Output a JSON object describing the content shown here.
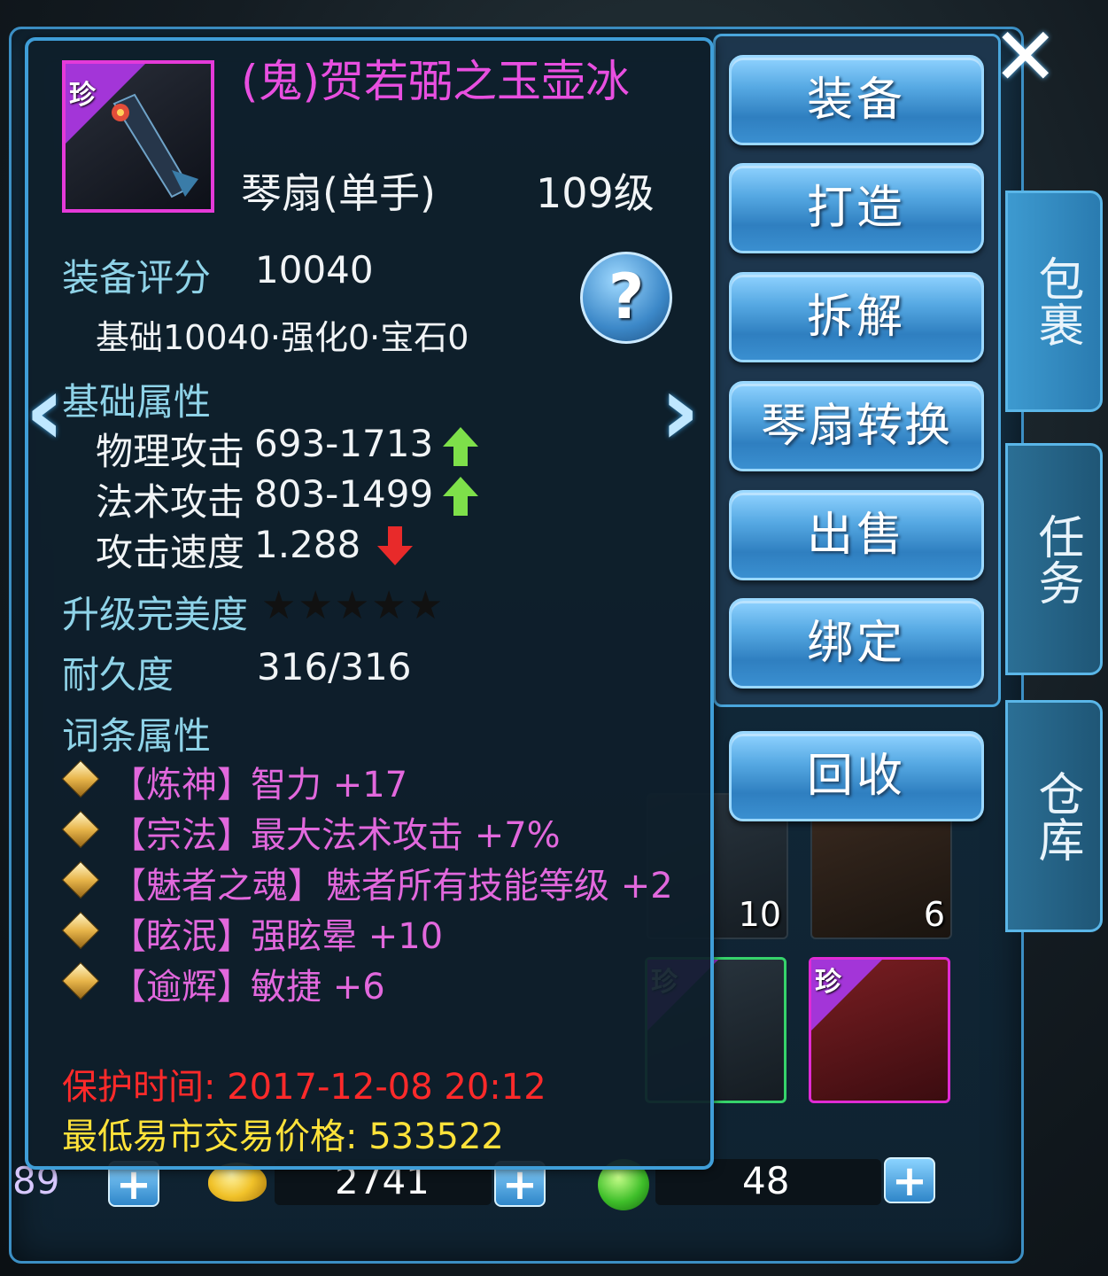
{
  "item": {
    "rarity_tag": "珍",
    "name": "(鬼)贺若弼之玉壶冰",
    "type": "琴扇(单手)",
    "level": "109级"
  },
  "score": {
    "label": "装备评分",
    "value": "10040",
    "breakdown": "基础10040·强化0·宝石0"
  },
  "base_attrs": {
    "heading": "基础属性",
    "rows": [
      {
        "name": "物理攻击",
        "value": "693-1713",
        "trend": "up"
      },
      {
        "name": "法术攻击",
        "value": "803-1499",
        "trend": "up"
      },
      {
        "name": "攻击速度",
        "value": "1.288",
        "trend": "down"
      }
    ]
  },
  "perfection": {
    "label": "升级完美度",
    "stars": "★★★★★",
    "filled": 0,
    "total": 5
  },
  "durability": {
    "label": "耐久度",
    "value": "316/316"
  },
  "affixes": {
    "heading": "词条属性",
    "rows": [
      {
        "tag": "【炼神】",
        "text": "智力 +17"
      },
      {
        "tag": "【宗法】",
        "text": "最大法术攻击 +7%"
      },
      {
        "tag": "【魅者之魂】",
        "text": "魅者所有技能等级 +2"
      },
      {
        "tag": "【眩泯】",
        "text": "强眩晕 +10"
      },
      {
        "tag": "【逾辉】",
        "text": "敏捷 +6"
      }
    ]
  },
  "protect_time": "保护时间: 2017-12-08 20:12",
  "min_price": "最低易市交易价格: 533522",
  "help_label": "?",
  "nav": {
    "prev": "‹",
    "next": "›"
  },
  "actions": [
    "装备",
    "打造",
    "拆解",
    "琴扇转换",
    "出售",
    "绑定",
    "回收"
  ],
  "side_tabs": [
    "包裹",
    "任务",
    "仓库"
  ],
  "close_label": "✕",
  "currency": {
    "c1": "89",
    "c2": "2741",
    "c3": "48",
    "plus": "+"
  },
  "bag_slots": {
    "s1_count": "10",
    "s2_count": "6",
    "rare_tag": "珍"
  },
  "colors": {
    "title": "#e84fe0",
    "cyan": "#8fd3e8",
    "pink": "#e268dd",
    "red": "#ff2a2a",
    "yellow": "#ffe23a",
    "accent": "#3f9ed8"
  }
}
